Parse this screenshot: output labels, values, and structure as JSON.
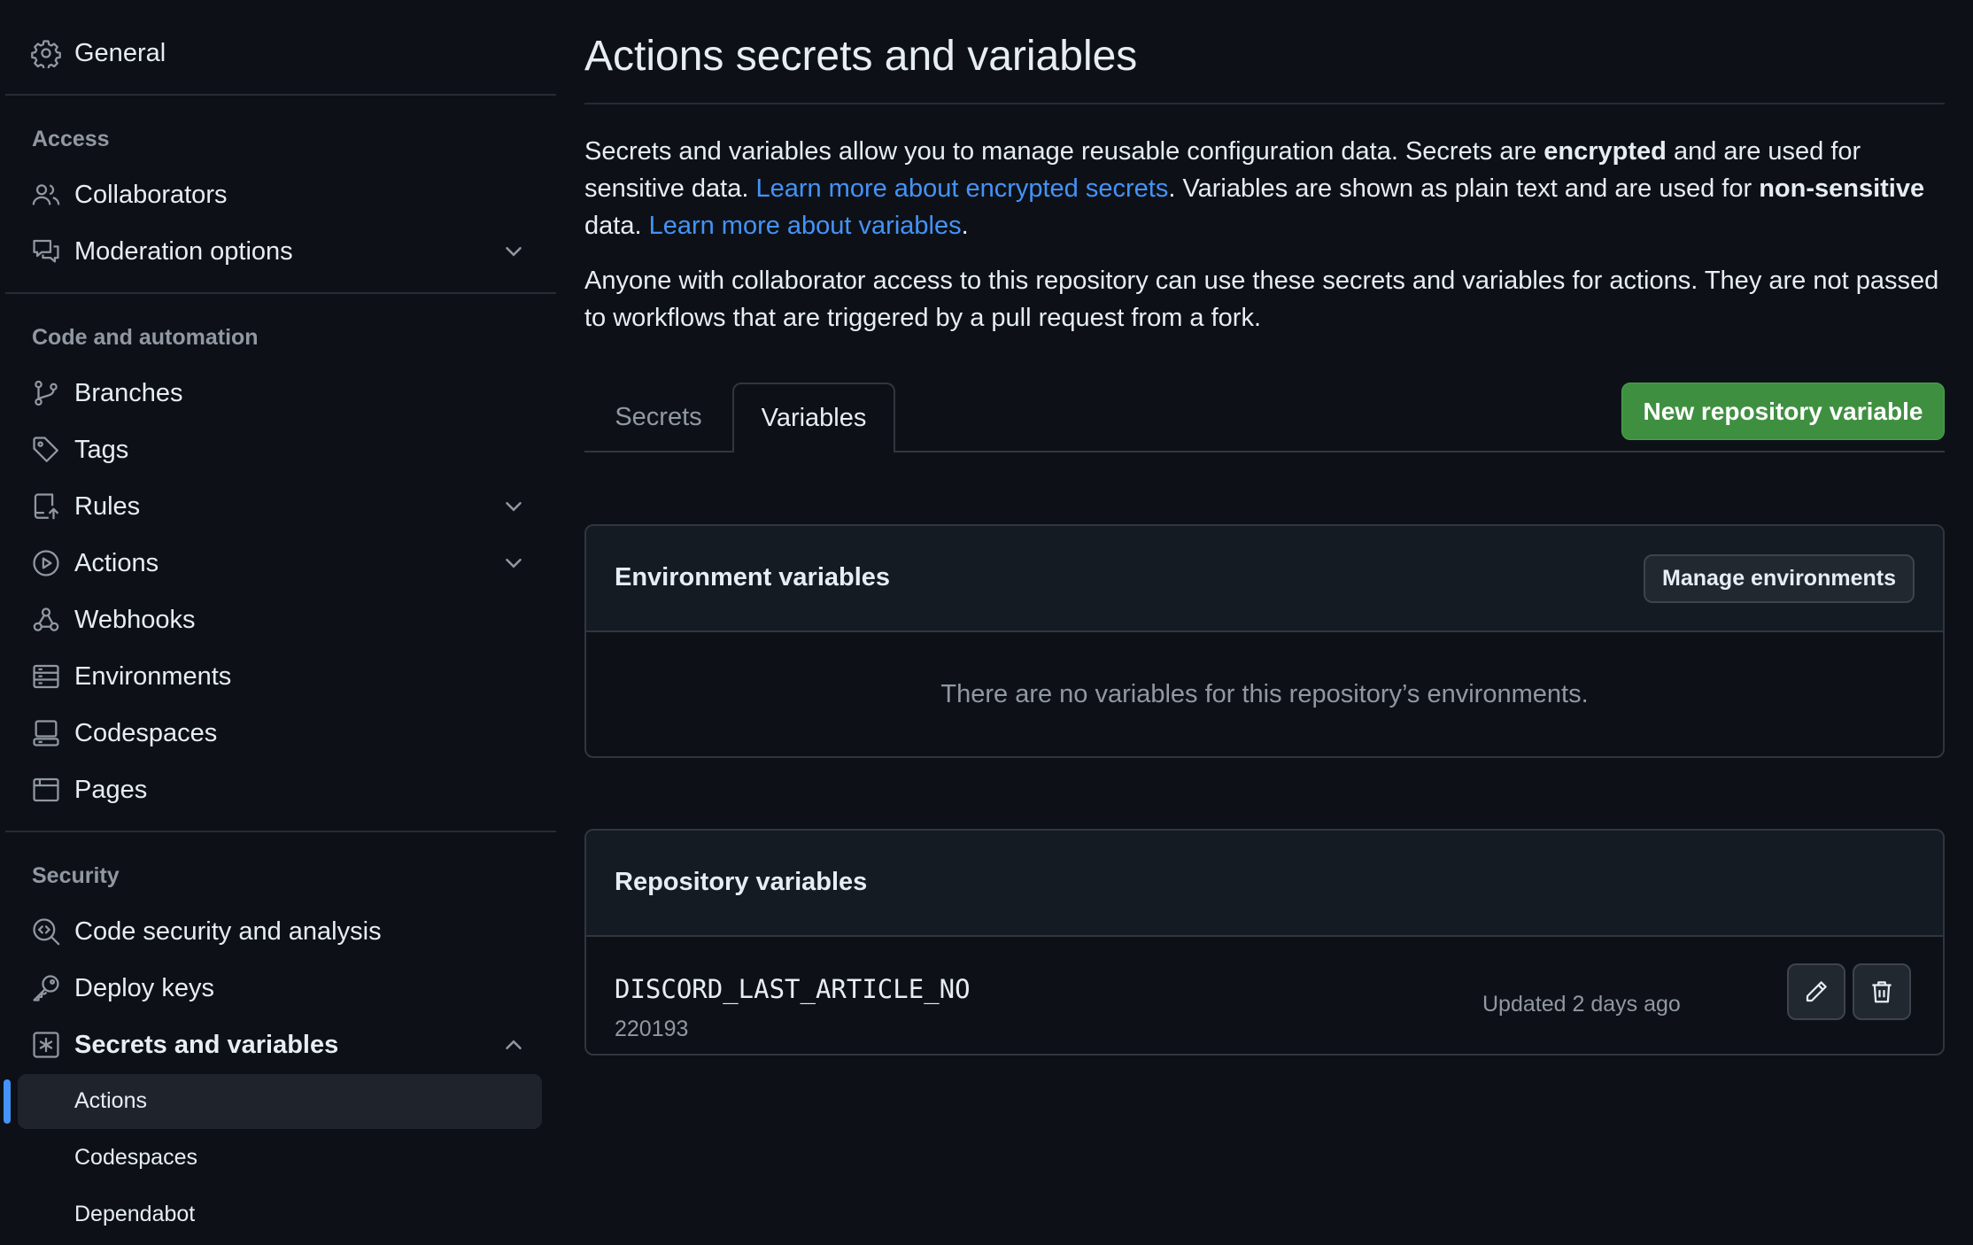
{
  "sidebar": {
    "general": "General",
    "sections": {
      "access": "Access",
      "code_automation": "Code and automation",
      "security": "Security"
    },
    "items": {
      "collaborators": "Collaborators",
      "moderation": "Moderation options",
      "branches": "Branches",
      "tags": "Tags",
      "rules": "Rules",
      "actions": "Actions",
      "webhooks": "Webhooks",
      "environments": "Environments",
      "codespaces": "Codespaces",
      "pages": "Pages",
      "code_security": "Code security and analysis",
      "deploy_keys": "Deploy keys",
      "secrets_variables": "Secrets and variables"
    },
    "sub_items": {
      "actions": "Actions",
      "codespaces": "Codespaces",
      "dependabot": "Dependabot"
    }
  },
  "main": {
    "title": "Actions secrets and variables",
    "intro": {
      "p1_a": "Secrets and variables allow you to manage reusable configuration data. Secrets are ",
      "p1_b": "encrypted",
      "p1_c": " and are used for sensitive data. ",
      "p1_link1": "Learn more about encrypted secrets",
      "p1_d": ". Variables are shown as plain text and are used for ",
      "p1_e": "non-sensitive",
      "p1_f": " data. ",
      "p1_link2": "Learn more about variables",
      "p1_g": ".",
      "p2": "Anyone with collaborator access to this repository can use these secrets and variables for actions. They are not passed to workflows that are triggered by a pull request from a fork."
    },
    "tabs": {
      "secrets": "Secrets",
      "variables": "Variables"
    },
    "new_button": "New repository variable",
    "env_panel": {
      "title": "Environment variables",
      "manage_button": "Manage environments",
      "empty": "There are no variables for this repository’s environments."
    },
    "repo_panel": {
      "title": "Repository variables",
      "variables": [
        {
          "name": "DISCORD_LAST_ARTICLE_NO",
          "value": "220193",
          "updated": "Updated 2 days ago"
        }
      ]
    }
  },
  "colors": {
    "background": "#0d1117",
    "accent_link": "#4493f8",
    "primary_button": "#3f8f41",
    "muted_text": "#9198a1"
  }
}
